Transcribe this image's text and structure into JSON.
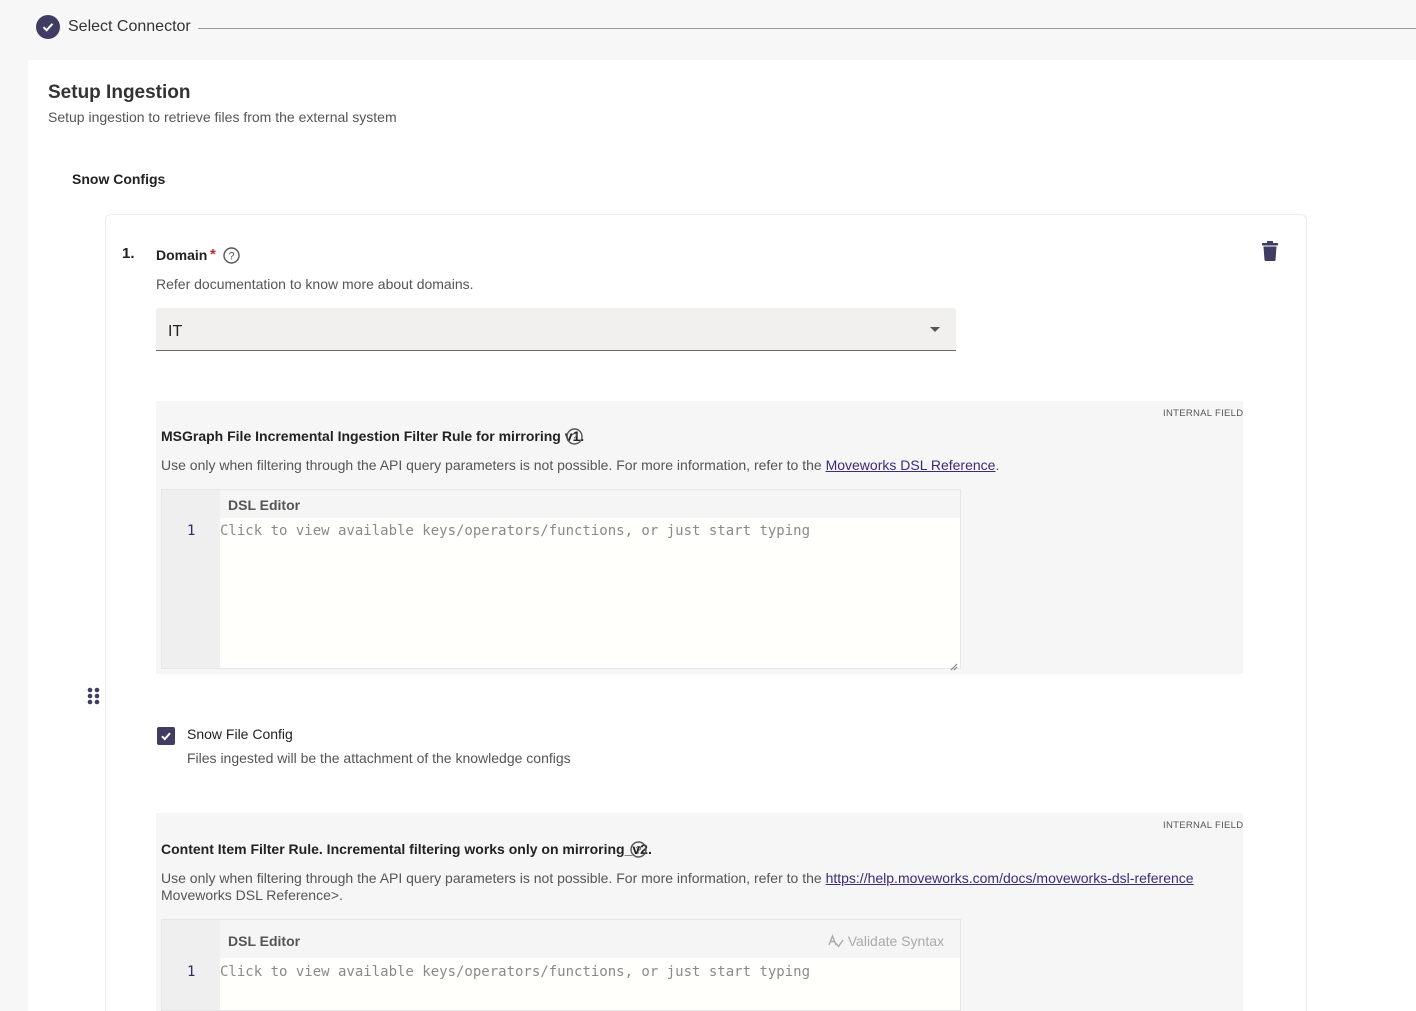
{
  "stepper": {
    "step_label": "Select Connector",
    "accent": "#3f3d63"
  },
  "page": {
    "title": "Setup Ingestion",
    "subtitle": "Setup ingestion to retrieve files from the external system",
    "section_title": "Snow Configs"
  },
  "config_item": {
    "number": "1.",
    "domain": {
      "label": "Domain",
      "required_mark": "*",
      "description": "Refer documentation to know more about domains.",
      "selected_value": "IT"
    },
    "msgraph_rule": {
      "tag": "INTERNAL FIELD",
      "title": "MSGraph File Incremental Ingestion Filter Rule for mirroring v1.",
      "description_prefix": "Use only when filtering through the API query parameters is not possible. For more information, refer to the ",
      "link_text": "Moveworks DSL Reference",
      "description_suffix": ".",
      "editor": {
        "title": "DSL Editor",
        "line_number": "1",
        "placeholder": "Click to view available keys/operators/functions, or just start typing"
      }
    },
    "snow_file_config": {
      "label": "Snow File Config",
      "description": "Files ingested will be the attachment of the knowledge configs",
      "checked": true
    },
    "content_rule": {
      "tag": "INTERNAL FIELD",
      "title": "Content Item Filter Rule. Incremental filtering works only on mirroring_v2.",
      "description_prefix": "Use only when filtering through the API query parameters is not possible. For more information, refer to the ",
      "link_text": "https://help.moveworks.com/docs/moveworks-dsl-reference",
      "description_suffix": " Moveworks DSL Reference>.",
      "editor": {
        "title": "DSL Editor",
        "validate_label": "Validate Syntax",
        "line_number": "1",
        "placeholder": "Click to view available keys/operators/functions, or just start typing"
      }
    }
  },
  "colors": {
    "required": "#c62828",
    "link": "#3d2a7a",
    "background": "#f7f7f7"
  }
}
